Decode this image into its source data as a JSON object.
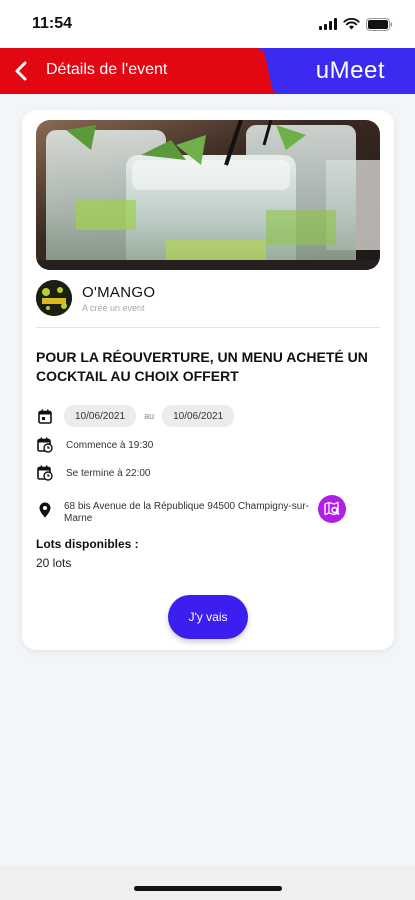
{
  "status": {
    "time": "11:54"
  },
  "header": {
    "title": "Détails de l'event",
    "logo": "uMeet",
    "colors": {
      "left": "#e30613",
      "right": "#3b2bf0"
    }
  },
  "event": {
    "organizer": {
      "name": "O'MANGO",
      "subtitle": "A créé un event"
    },
    "title": "POUR LA RÉOUVERTURE, UN MENU ACHETÉ UN COCKTAIL AU CHOIX OFFERT",
    "date_start": "10/06/2021",
    "date_separator": "au",
    "date_end": "10/06/2021",
    "starts": "Commence à 19:30",
    "ends": "Se termine à 22:00",
    "address": "68 bis Avenue de la République 94500 Champigny-sur-Marne",
    "lots_label": "Lots disponibles :",
    "lots_value": "20 lots"
  },
  "cta": {
    "label": "J'y vais",
    "color": "#3b1ff0"
  },
  "icons": [
    "back-arrow-icon",
    "calendar-icon",
    "calendar-clock-icon",
    "location-pin-icon",
    "map-search-icon",
    "wifi-icon",
    "battery-icon",
    "signal-icon"
  ]
}
